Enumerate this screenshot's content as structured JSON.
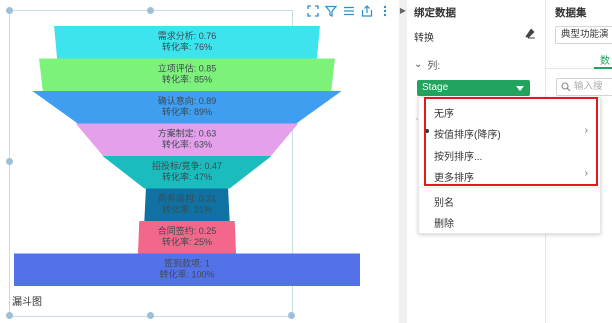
{
  "widget": {
    "title": "漏斗图",
    "toolbar_icons": [
      "expand-icon",
      "filter-icon",
      "list-icon",
      "export-icon",
      "more-icon"
    ]
  },
  "chart_data": {
    "type": "funnel",
    "stages": [
      {
        "name": "需求分析",
        "value": 0.76,
        "rate": "76%",
        "color": "#3de3ed"
      },
      {
        "name": "立项评估",
        "value": 0.85,
        "rate": "85%",
        "color": "#7df27b"
      },
      {
        "name": "确认意向",
        "value": 0.89,
        "rate": "89%",
        "color": "#3f9ef0"
      },
      {
        "name": "方案制定",
        "value": 0.63,
        "rate": "63%",
        "color": "#e4a0ea"
      },
      {
        "name": "招投标/竞争",
        "value": 0.47,
        "rate": "47%",
        "color": "#1abcbd"
      },
      {
        "name": "商务谈判",
        "value": 0.21,
        "rate": "21%",
        "color": "#0f72a3"
      },
      {
        "name": "合同签约",
        "value": 0.25,
        "rate": "25%",
        "color": "#f2678a"
      },
      {
        "name": "签到款项",
        "value": 1,
        "rate": "100%",
        "color": "#5472e8"
      }
    ],
    "rate_label": "转化率"
  },
  "bind_panel": {
    "title": "绑定数据",
    "transform_label": "转换",
    "columns_label": "列:",
    "field_value": "Stage"
  },
  "context_menu": {
    "items": [
      {
        "label": "无序",
        "selected": false,
        "has_submenu": false
      },
      {
        "label": "按值排序(降序)",
        "selected": true,
        "has_submenu": true
      },
      {
        "label": "按列排序...",
        "selected": false,
        "has_submenu": false
      },
      {
        "label": "更多排序",
        "selected": false,
        "has_submenu": true
      }
    ],
    "extra_items": [
      {
        "label": "别名"
      },
      {
        "label": "删除"
      }
    ]
  },
  "dataset_panel": {
    "title": "数据集",
    "selected_dataset": "典型功能演",
    "tab_label": "数",
    "search_placeholder": "输入搜"
  },
  "colors": {
    "accent": "#22a45e",
    "highlight": "#e0191f"
  }
}
